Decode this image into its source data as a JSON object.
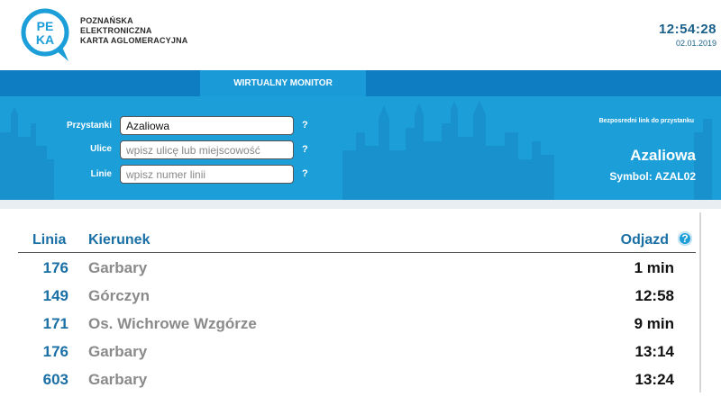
{
  "header": {
    "logo": {
      "top": "PE",
      "bottom": "KA"
    },
    "brand_lines": [
      "POZNAŃSKA",
      "ELEKTRONICZNA",
      "KARTA AGLOMERACYJNA"
    ],
    "time": "12:54:28",
    "date": "02.01.2019"
  },
  "nav": {
    "active_tab": "WIRTUALNY MONITOR"
  },
  "search": {
    "stop": {
      "label": "Przystanki",
      "value": "Azaliowa",
      "placeholder": ""
    },
    "street": {
      "label": "Ulice",
      "value": "",
      "placeholder": "wpisz ulicę lub miejscowość"
    },
    "line": {
      "label": "Linie",
      "value": "",
      "placeholder": "wpisz numer linii"
    },
    "help": "?"
  },
  "stop_info": {
    "direct_link": "Bezposredni link do przystanku",
    "name": "Azaliowa",
    "symbol": "Symbol: AZAL02"
  },
  "board": {
    "headers": {
      "line": "Linia",
      "direction": "Kierunek",
      "departure": "Odjazd",
      "help": "?"
    },
    "rows": [
      {
        "line": "176",
        "direction": "Garbary",
        "departure": "1 min"
      },
      {
        "line": "149",
        "direction": "Górczyn",
        "departure": "12:58"
      },
      {
        "line": "171",
        "direction": "Os. Wichrowe Wzgórze",
        "departure": "9 min"
      },
      {
        "line": "176",
        "direction": "Garbary",
        "departure": "13:14"
      },
      {
        "line": "603",
        "direction": "Garbary",
        "departure": "13:24"
      }
    ]
  },
  "colors": {
    "brand_blue": "#1c9ed9",
    "nav_blue": "#0e7dc1",
    "line_blue": "#1a6fa5",
    "direction_gray": "#8a8a8a"
  }
}
